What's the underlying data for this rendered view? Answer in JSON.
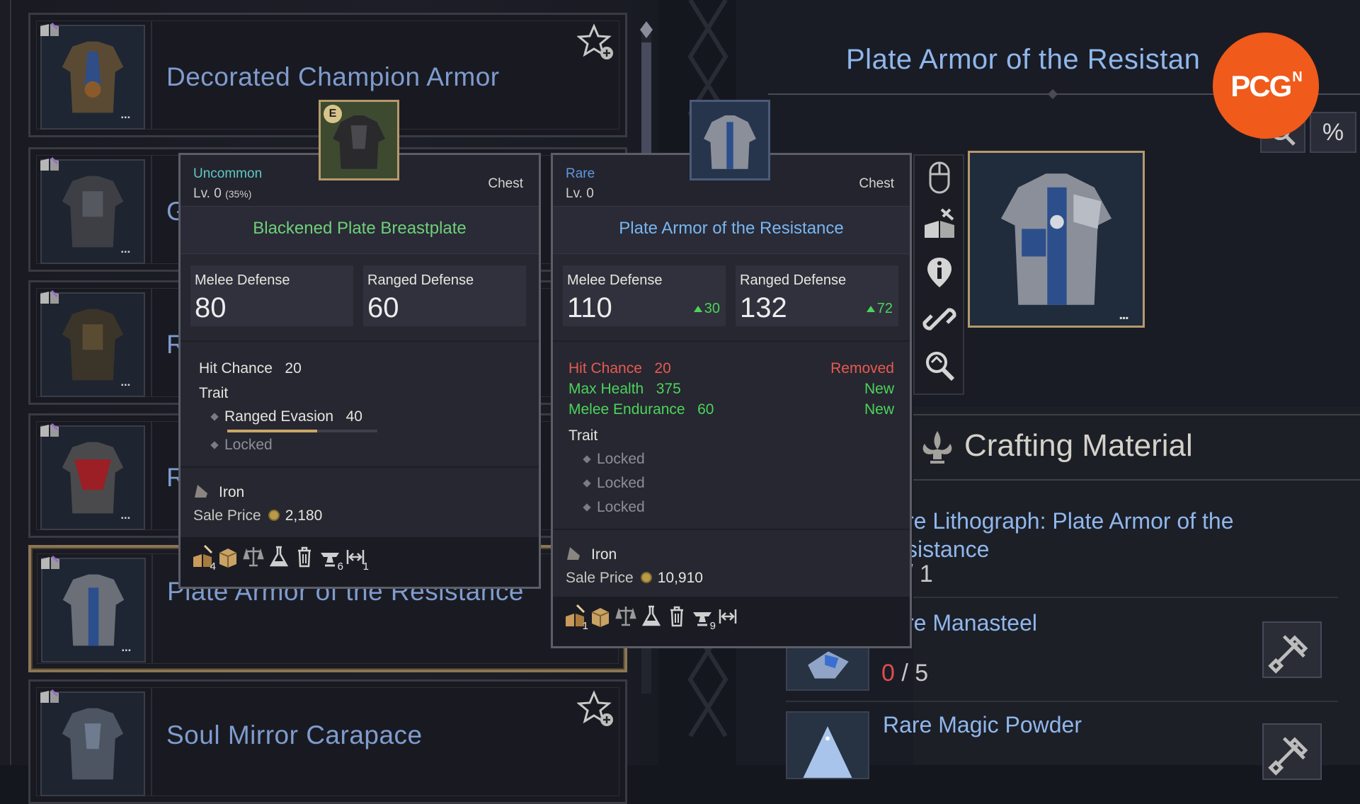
{
  "list": {
    "items": [
      {
        "name": "Decorated Champion Armor",
        "dots": "▪▪▪",
        "favorite": true
      },
      {
        "name": "G",
        "dots": "▪▪▪",
        "favorite": false
      },
      {
        "name": "R",
        "dots": "▪▪▪",
        "favorite": false
      },
      {
        "name": "R",
        "dots": "▪▪▪",
        "favorite": false
      },
      {
        "name": "Plate Armor of the Resistance",
        "dots": "▪▪▪",
        "favorite": false,
        "selected": true
      },
      {
        "name": "Soul Mirror Carapace",
        "dots": "▪▪▪",
        "favorite": true
      }
    ]
  },
  "header": {
    "title": "Plate Armor of the Resistan",
    "percent_button": "%",
    "preview_dots": "▪▪▪"
  },
  "badge": {
    "text": "PCG",
    "sup": "N"
  },
  "tooltip_equipped": {
    "equip_badge": "E",
    "rarity": "Uncommon",
    "rarity_color": "#5fc9c6",
    "level": "Lv. 0",
    "level_pct": "(35%)",
    "slot": "Chest",
    "name": "Blackened Plate Breastplate",
    "name_color": "#6fd07a",
    "stats": [
      {
        "label": "Melee Defense",
        "value": "80"
      },
      {
        "label": "Ranged Defense",
        "value": "60"
      }
    ],
    "hit_chance_label": "Hit Chance",
    "hit_chance_value": "20",
    "trait_label": "Trait",
    "traits": [
      {
        "label": "Ranged Evasion",
        "value": "40",
        "progress": 0.6
      },
      {
        "label": "Locked",
        "value": ""
      }
    ],
    "material": "Iron",
    "sale_label": "Sale Price",
    "sale_value": "2,180",
    "footer_counts": [
      "4",
      "",
      "",
      "",
      "",
      "6",
      "1"
    ]
  },
  "tooltip_compare": {
    "rarity": "Rare",
    "rarity_color": "#5f97e0",
    "level": "Lv. 0",
    "slot": "Chest",
    "name": "Plate Armor of the Resistance",
    "name_color": "#79b6f0",
    "stats": [
      {
        "label": "Melee Defense",
        "value": "110",
        "delta": "30"
      },
      {
        "label": "Ranged Defense",
        "value": "132",
        "delta": "72"
      }
    ],
    "changes": [
      {
        "label": "Hit Chance",
        "value": "20",
        "status": "Removed"
      },
      {
        "label": "Max Health",
        "value": "375",
        "status": "New"
      },
      {
        "label": "Melee Endurance",
        "value": "60",
        "status": "New"
      }
    ],
    "trait_label": "Trait",
    "traits": [
      "Locked",
      "Locked",
      "Locked"
    ],
    "material": "Iron",
    "sale_label": "Sale Price",
    "sale_value": "10,910",
    "footer_counts": [
      "1",
      "",
      "",
      "",
      "",
      "9",
      ""
    ]
  },
  "crafting": {
    "title": "Crafting Material",
    "items": [
      {
        "name_line1": "re Lithograph: Plate Armor of the",
        "name_line2": "sistance",
        "count": "/ 1"
      },
      {
        "name": "re Manasteel",
        "have": "0",
        "need": "/ 5"
      },
      {
        "name": "Rare Magic Powder"
      }
    ]
  },
  "colors": {
    "accent_blue": "#8fb7ec",
    "positive": "#4cd35a",
    "removed": "#e85a4f",
    "gold_border": "#b59a6c",
    "badge_orange": "#f05a1a"
  }
}
